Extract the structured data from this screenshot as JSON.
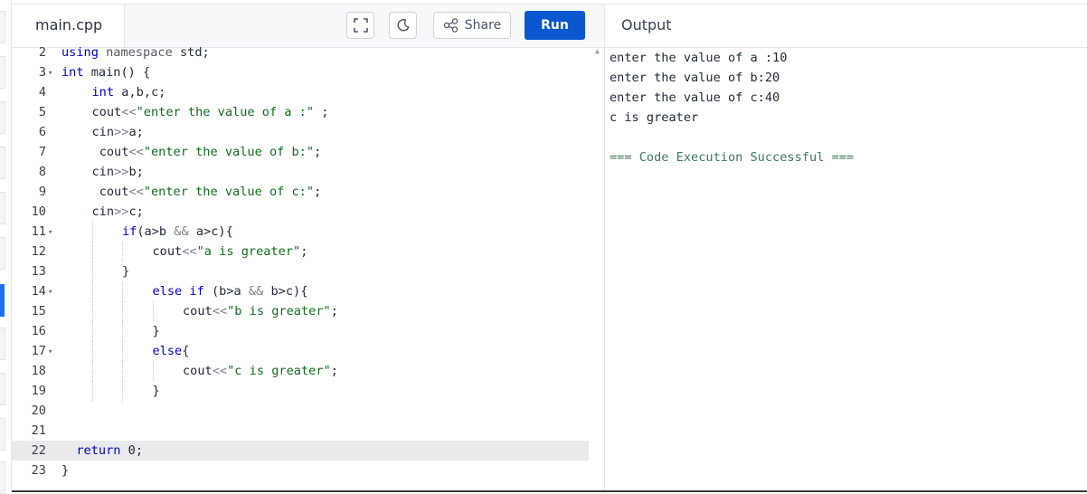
{
  "editor": {
    "file_name": "main.cpp",
    "share_label": "Share",
    "run_label": "Run",
    "lines": [
      {
        "n": "2",
        "fold": false,
        "hl": false,
        "indent": 0,
        "tokens": [
          {
            "t": "using",
            "c": "kw"
          },
          {
            "t": " "
          },
          {
            "t": "namespace",
            "c": "ns"
          },
          {
            "t": " std;"
          }
        ]
      },
      {
        "n": "3",
        "fold": true,
        "hl": false,
        "indent": 0,
        "tokens": [
          {
            "t": "int",
            "c": "kw"
          },
          {
            "t": " main() {"
          }
        ]
      },
      {
        "n": "4",
        "fold": false,
        "hl": false,
        "indent": 1,
        "tokens": [
          {
            "t": "int",
            "c": "kw"
          },
          {
            "t": " a,b,c;"
          }
        ]
      },
      {
        "n": "5",
        "fold": false,
        "hl": false,
        "indent": 1,
        "tokens": [
          {
            "t": "cout"
          },
          {
            "t": "<<",
            "c": "op"
          },
          {
            "t": "\"enter the value of a :\"",
            "c": "str"
          },
          {
            "t": " ;"
          }
        ]
      },
      {
        "n": "6",
        "fold": false,
        "hl": false,
        "indent": 1,
        "tokens": [
          {
            "t": "cin"
          },
          {
            "t": ">>",
            "c": "op"
          },
          {
            "t": "a;"
          }
        ]
      },
      {
        "n": "7",
        "fold": false,
        "hl": false,
        "indent": 1,
        "extra": " ",
        "tokens": [
          {
            "t": "cout"
          },
          {
            "t": "<<",
            "c": "op"
          },
          {
            "t": "\"enter the value of b:\"",
            "c": "str"
          },
          {
            "t": ";"
          }
        ]
      },
      {
        "n": "8",
        "fold": false,
        "hl": false,
        "indent": 1,
        "tokens": [
          {
            "t": "cin"
          },
          {
            "t": ">>",
            "c": "op"
          },
          {
            "t": "b;"
          }
        ]
      },
      {
        "n": "9",
        "fold": false,
        "hl": false,
        "indent": 1,
        "extra": " ",
        "tokens": [
          {
            "t": "cout"
          },
          {
            "t": "<<",
            "c": "op"
          },
          {
            "t": "\"enter the value of c:\"",
            "c": "str"
          },
          {
            "t": ";"
          }
        ]
      },
      {
        "n": "10",
        "fold": false,
        "hl": false,
        "indent": 1,
        "tokens": [
          {
            "t": "cin"
          },
          {
            "t": ">>",
            "c": "op"
          },
          {
            "t": "c;"
          }
        ]
      },
      {
        "n": "11",
        "fold": true,
        "hl": false,
        "indent": 2,
        "tokens": [
          {
            "t": "if",
            "c": "kw"
          },
          {
            "t": "(a>b "
          },
          {
            "t": "&&",
            "c": "op"
          },
          {
            "t": " a>c){"
          }
        ]
      },
      {
        "n": "12",
        "fold": false,
        "hl": false,
        "indent": 3,
        "tokens": [
          {
            "t": "cout"
          },
          {
            "t": "<<",
            "c": "op"
          },
          {
            "t": "\"a is greater\"",
            "c": "str"
          },
          {
            "t": ";"
          }
        ]
      },
      {
        "n": "13",
        "fold": false,
        "hl": false,
        "indent": 2,
        "tokens": [
          {
            "t": "}"
          }
        ]
      },
      {
        "n": "14",
        "fold": true,
        "hl": false,
        "indent": 3,
        "tokens": [
          {
            "t": "else if",
            "c": "kw"
          },
          {
            "t": " (b>a "
          },
          {
            "t": "&&",
            "c": "op"
          },
          {
            "t": " b>c){"
          }
        ]
      },
      {
        "n": "15",
        "fold": false,
        "hl": false,
        "indent": 4,
        "tokens": [
          {
            "t": "cout"
          },
          {
            "t": "<<",
            "c": "op"
          },
          {
            "t": "\"b is greater\"",
            "c": "str"
          },
          {
            "t": ";"
          }
        ]
      },
      {
        "n": "16",
        "fold": false,
        "hl": false,
        "indent": 3,
        "tokens": [
          {
            "t": "}"
          }
        ]
      },
      {
        "n": "17",
        "fold": true,
        "hl": false,
        "indent": 3,
        "tokens": [
          {
            "t": "else",
            "c": "kw"
          },
          {
            "t": "{"
          }
        ]
      },
      {
        "n": "18",
        "fold": false,
        "hl": false,
        "indent": 4,
        "tokens": [
          {
            "t": "cout"
          },
          {
            "t": "<<",
            "c": "op"
          },
          {
            "t": "\"c is greater\"",
            "c": "str"
          },
          {
            "t": ";"
          }
        ]
      },
      {
        "n": "19",
        "fold": false,
        "hl": false,
        "indent": 3,
        "tokens": [
          {
            "t": "}"
          }
        ]
      },
      {
        "n": "20",
        "fold": false,
        "hl": false,
        "indent": 0,
        "tokens": []
      },
      {
        "n": "21",
        "fold": false,
        "hl": false,
        "indent": 0,
        "tokens": []
      },
      {
        "n": "22",
        "fold": false,
        "hl": true,
        "indent": 0,
        "extra": "  ",
        "tokens": [
          {
            "t": "return",
            "c": "kw"
          },
          {
            "t": " 0;"
          }
        ]
      },
      {
        "n": "23",
        "fold": false,
        "hl": false,
        "indent": 0,
        "tokens": [
          {
            "t": "}"
          }
        ]
      }
    ]
  },
  "output": {
    "title": "Output",
    "lines": [
      "enter the value of a :10",
      "enter the value of b:20",
      "enter the value of c:40",
      "c is greater",
      "",
      "=== Code Execution Successful ==="
    ]
  },
  "colors": {
    "run_button": "#0b57d0",
    "keyword": "#0000c8",
    "string": "#0f6e1a",
    "success": "#3f7a5a",
    "active_sidebar_tab": "#1d6ff2"
  }
}
